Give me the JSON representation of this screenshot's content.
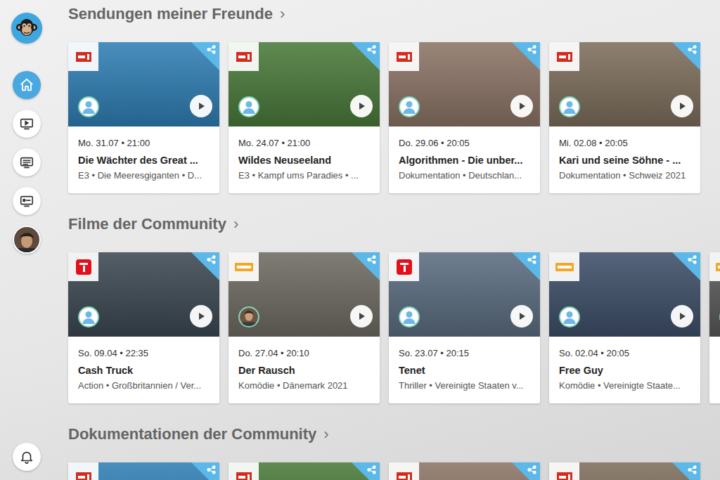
{
  "sidebar": {
    "items": [
      {
        "kind": "home",
        "selected": true
      },
      {
        "kind": "tv",
        "selected": false
      },
      {
        "kind": "guide",
        "selected": false
      },
      {
        "kind": "rec",
        "selected": false
      },
      {
        "kind": "profile",
        "selected": false
      },
      {
        "kind": "bell",
        "selected": false
      }
    ]
  },
  "sections": [
    {
      "title": "Sendungen meiner Freunde",
      "arrow": "›",
      "cards": [
        {
          "channel": "srf",
          "avatar": "generic",
          "color": "#2f7fb5",
          "date": "Mo. 31.07 • 21:00",
          "title": "Die Wächter des Great ...",
          "subtitle": "E3 • Die Meeresgiganten • D..."
        },
        {
          "channel": "srf",
          "avatar": "generic",
          "color": "#4a7a3a",
          "date": "Mo. 24.07 • 21:00",
          "title": "Wildes Neuseeland",
          "subtitle": "E3 • Kampf ums Paradies • ..."
        },
        {
          "channel": "srf",
          "avatar": "generic",
          "color": "#8c7466",
          "date": "Do. 29.06 • 20:05",
          "title": "Algorithmen - Die unber...",
          "subtitle": "Dokumentation • Deutschlan..."
        },
        {
          "channel": "srf",
          "avatar": "generic",
          "color": "#7d6e5c",
          "date": "Mi. 02.08 • 20:05",
          "title": "Kari und seine Söhne - ...",
          "subtitle": "Dokumentation • Schweiz 2021"
        }
      ]
    },
    {
      "title": "Filme der Community",
      "arrow": "›",
      "cards": [
        {
          "channel": "pro7",
          "avatar": "generic",
          "color": "#3c4852",
          "date": "So. 09.04 • 22:35",
          "title": "Cash Truck",
          "subtitle": "Action • Großbritannien / Ver..."
        },
        {
          "channel": "zdfneo",
          "avatar": "photo",
          "color": "#6e6b62",
          "date": "Do. 27.04 • 20:10",
          "title": "Der Rausch",
          "subtitle": "Komödie • Dänemark 2021"
        },
        {
          "channel": "pro7",
          "avatar": "generic",
          "color": "#5b6d80",
          "date": "So. 23.07 • 20:15",
          "title": "Tenet",
          "subtitle": "Thriller • Vereinigte Staaten v..."
        },
        {
          "channel": "zdfneo",
          "avatar": "generic",
          "color": "#3e4f69",
          "date": "So. 02.04 • 20:05",
          "title": "Free Guy",
          "subtitle": "Komödie • Vereinigte Staate..."
        },
        {
          "channel": "zdfneo",
          "avatar": "generic",
          "color": "#5a5a5a"
        }
      ]
    },
    {
      "title": "Dokumentationen der Community",
      "arrow": "›",
      "cards": [
        {
          "channel": "srf",
          "avatar": "generic",
          "color": "#2f7fb5"
        },
        {
          "channel": "srf",
          "avatar": "generic",
          "color": "#4a7a3a"
        },
        {
          "channel": "srf",
          "avatar": "generic",
          "color": "#8c7466"
        },
        {
          "channel": "srf",
          "avatar": "generic",
          "color": "#7d6e5c"
        }
      ]
    }
  ]
}
